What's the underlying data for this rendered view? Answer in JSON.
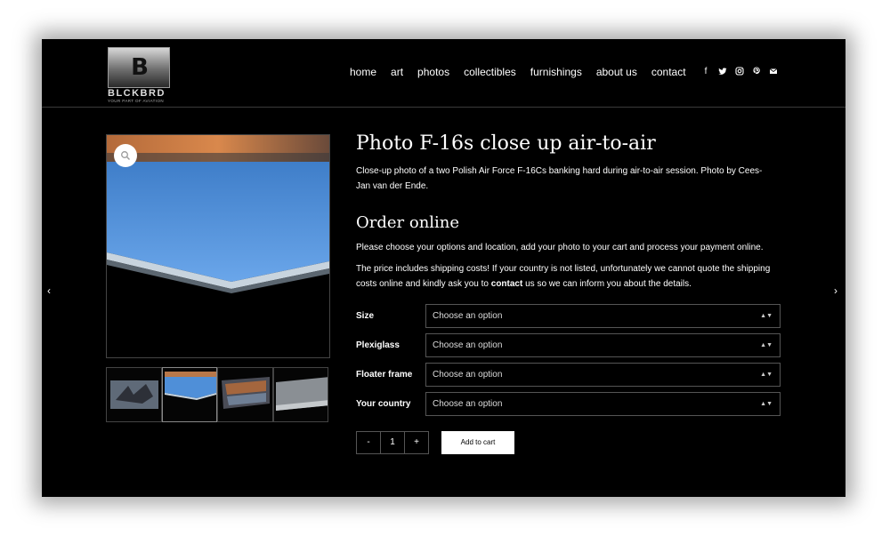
{
  "logo": {
    "mark": "B",
    "name": "BLCKBRD",
    "tagline": "YOUR PART OF AVIATION"
  },
  "nav": [
    "home",
    "art",
    "photos",
    "collectibles",
    "furnishings",
    "about us",
    "contact"
  ],
  "social_icons": [
    "facebook-icon",
    "twitter-icon",
    "instagram-icon",
    "pinterest-icon",
    "mail-icon"
  ],
  "product": {
    "title": "Photo F-16s close up air-to-air",
    "description": "Close-up photo of a two Polish Air Force F-16Cs banking hard during air-to-air session. Photo by Cees-Jan van der Ende."
  },
  "order": {
    "heading": "Order online",
    "intro": "Please choose your options and location, add your photo to your cart and process your payment online.",
    "shipping_text_a": "The price includes shipping costs! If your country is not listed, unfortunately we cannot quote the shipping costs online and kindly ask you to ",
    "contact_link": "contact",
    "shipping_text_b": " us so we can inform you about the details."
  },
  "options": [
    {
      "label": "Size",
      "value": "Choose an option"
    },
    {
      "label": "Plexiglass",
      "value": "Choose an option"
    },
    {
      "label": "Floater frame",
      "value": "Choose an option"
    },
    {
      "label": "Your country",
      "value": "Choose an option"
    }
  ],
  "quantity": {
    "minus": "-",
    "value": "1",
    "plus": "+"
  },
  "add_to_cart": "Add to cart",
  "colors": {
    "background": "#000000",
    "accent_blue": "#4f8fd8",
    "button_bg": "#ffffff"
  }
}
